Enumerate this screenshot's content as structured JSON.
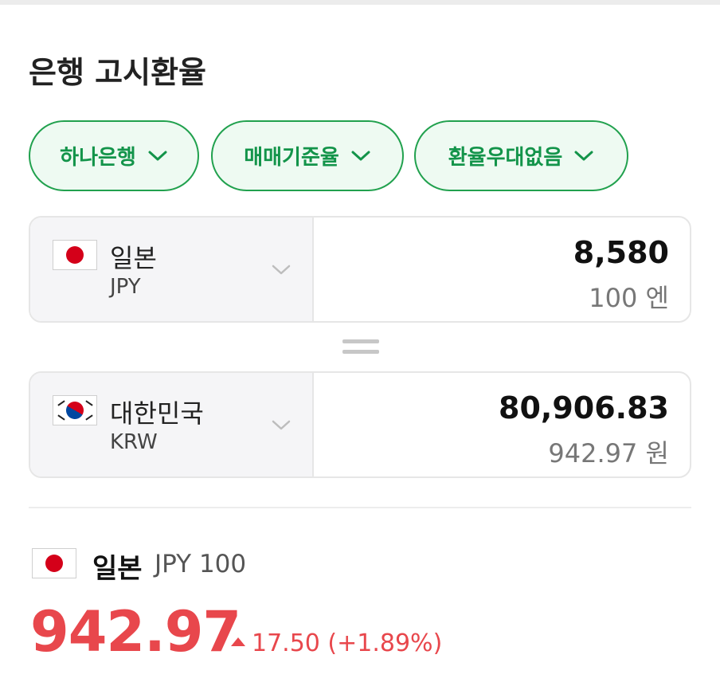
{
  "title": "은행 고시환율",
  "filters": [
    {
      "label": "하나은행"
    },
    {
      "label": "매매기준율"
    },
    {
      "label": "환율우대없음"
    }
  ],
  "from": {
    "country": "일본",
    "code": "JPY",
    "amount": "8,580",
    "unit": "100 엔",
    "flag_icon": "japan-flag-icon"
  },
  "to": {
    "country": "대한민국",
    "code": "KRW",
    "amount": "80,906.83",
    "unit": "942.97 원",
    "flag_icon": "korea-flag-icon"
  },
  "summary": {
    "country": "일본",
    "unit": "JPY 100",
    "rate": "942.97",
    "change": "17.50 (+1.89%)",
    "direction": "up"
  },
  "colors": {
    "accent_green": "#13944a",
    "pill_bg": "#eefaf2",
    "rise_red": "#e8474c"
  }
}
